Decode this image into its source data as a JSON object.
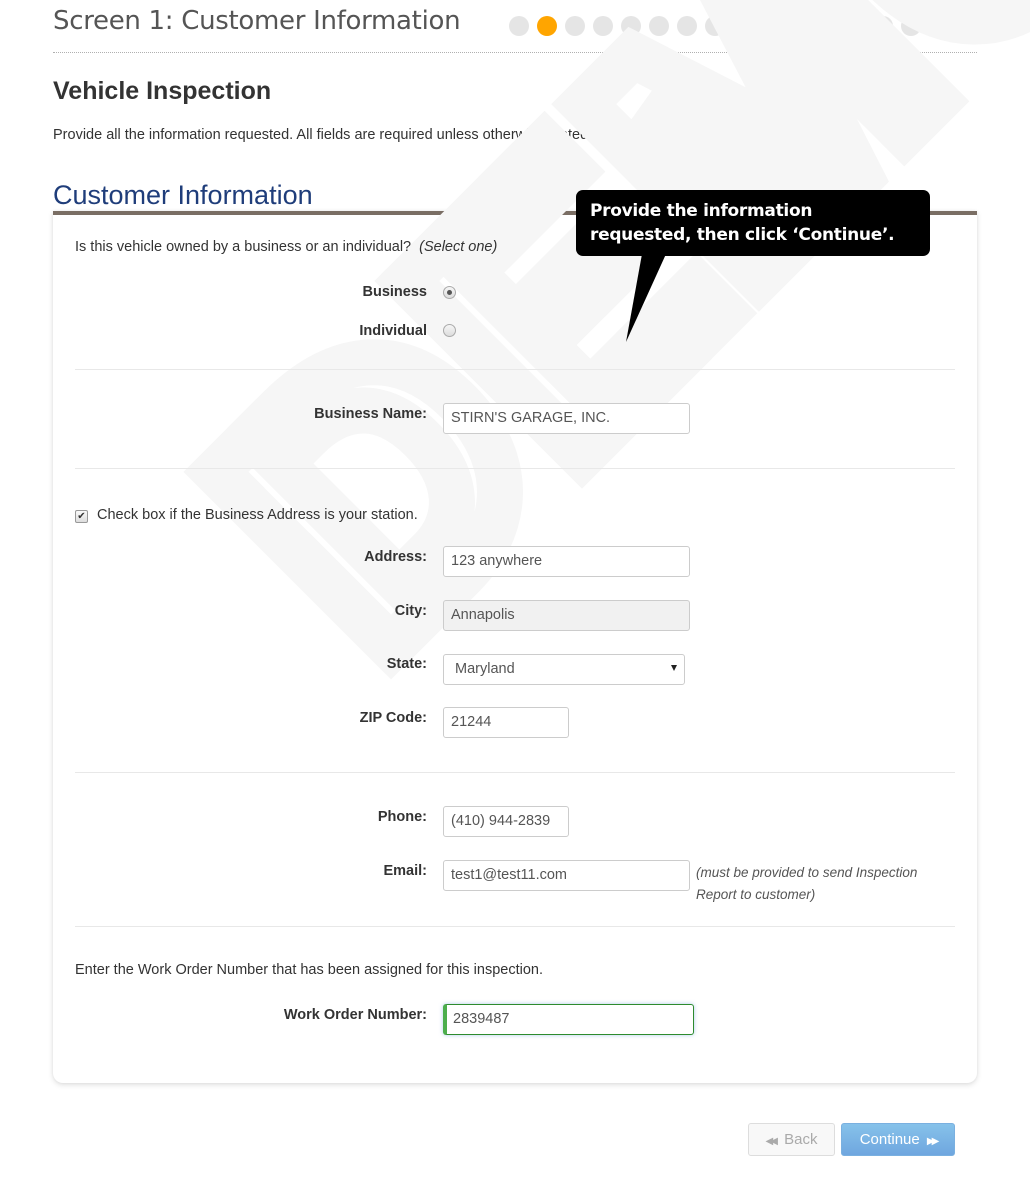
{
  "header": {
    "screen_title": "Screen 1: Customer Information",
    "progress": {
      "total_steps": 17,
      "current_step": 2,
      "active_color": "#ffa500",
      "inactive_color": "#e5e5e5"
    }
  },
  "page": {
    "heading": "Vehicle Inspection",
    "intro": "Provide all the information requested. All fields are required unless otherwise stated."
  },
  "section": {
    "title": "Customer Information",
    "title_color": "#1f3d7a",
    "watermark": "DEMO"
  },
  "ownership": {
    "question": "Is this vehicle owned by a business or an individual?",
    "hint": "(Select one)",
    "options": [
      {
        "label": "Business",
        "checked": true
      },
      {
        "label": "Individual",
        "checked": false
      }
    ]
  },
  "fields": {
    "business_name": {
      "label": "Business Name:",
      "value": "STIRN'S GARAGE, INC."
    },
    "station_checkbox": {
      "label": "Check box if the Business Address is your station.",
      "checked": true,
      "glyph": "✔"
    },
    "address": {
      "label": "Address:",
      "value": "123 anywhere"
    },
    "city": {
      "label": "City:",
      "value": "Annapolis"
    },
    "state": {
      "label": "State:",
      "value": "Maryland"
    },
    "zip": {
      "label": "ZIP Code:",
      "value": "21244"
    },
    "phone": {
      "label": "Phone:",
      "value": "(410) 944-2839"
    },
    "email": {
      "label": "Email:",
      "value": "test1@test11.com",
      "note": "(must be provided to send Inspection Report to customer)"
    },
    "work_order_prompt": "Enter the Work Order Number that has been assigned for this inspection.",
    "work_order": {
      "label": "Work Order Number:",
      "value": "2839487"
    }
  },
  "callout": {
    "text": "Provide the information requested, then click ‘Continue’."
  },
  "buttons": {
    "back": {
      "label": "Back",
      "icon": "◀◀"
    },
    "continue": {
      "label": "Continue",
      "icon": "▶▶"
    }
  }
}
